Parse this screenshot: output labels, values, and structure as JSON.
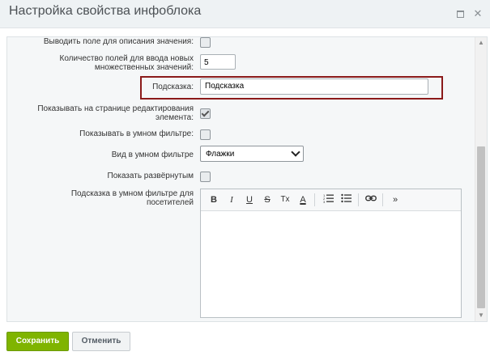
{
  "window": {
    "title": "Настройка свойства инфоблока"
  },
  "form": {
    "row_partial_label": "Выводить поле для описания значения:",
    "multi_count_label_line1": "Количество полей для ввода новых",
    "multi_count_label_line2": "множественных значений:",
    "multi_count_value": "5",
    "hint_label": "Подсказка:",
    "hint_value": "Подсказка",
    "show_on_edit_label_line1": "Показывать на странице редактирования",
    "show_on_edit_label_line2": "элемента:",
    "show_on_edit_checked": true,
    "show_in_smart_filter_label": "Показывать в умном фильтре:",
    "smart_filter_view_label": "Вид в умном фильтре",
    "smart_filter_view_value": "Флажки",
    "show_expanded_label": "Показать развёрнутым",
    "smart_filter_hint_label_line1": "Подсказка в умном фильтре для",
    "smart_filter_hint_label_line2": "посетителей"
  },
  "editor_toolbar": {
    "bold": "B",
    "italic": "I",
    "underline": "U",
    "strike": "S",
    "clear_format": "Tx",
    "text_color": "A",
    "more": "»"
  },
  "buttons": {
    "save": "Сохранить",
    "cancel": "Отменить"
  },
  "colors": {
    "save_button": "#7fb400",
    "highlight_border": "#8b1a1a"
  }
}
